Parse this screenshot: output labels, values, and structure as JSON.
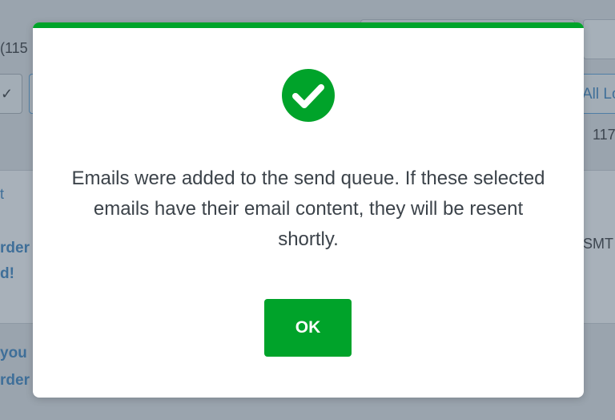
{
  "background": {
    "count_left": "(115",
    "all_button_label": "All Lo",
    "count_right": "117",
    "column_header": "t",
    "row_link_lines": [
      "rder",
      "d!"
    ],
    "row_smtp": "SMT",
    "row_link2_lines": [
      "you",
      "rder"
    ]
  },
  "modal": {
    "accent_color": "#00a32a",
    "icon": "check-circle-icon",
    "message": "Emails were added to the send queue. If these selected emails have their email content, they will be resent shortly.",
    "ok_label": "OK"
  }
}
